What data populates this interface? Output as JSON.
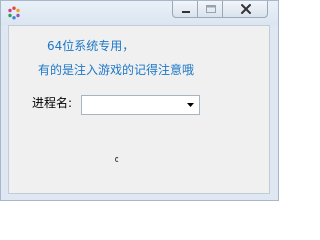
{
  "window": {
    "title": "",
    "icon": "app-icon",
    "titlebar_buttons": [
      {
        "name": "minimize",
        "icon": "minimize-icon"
      },
      {
        "name": "maximize",
        "icon": "maximize-icon"
      },
      {
        "name": "close",
        "icon": "close-icon"
      }
    ]
  },
  "notes": {
    "line1": "64位系统专用，",
    "line2": "有的是注入游戏的记得注意哦"
  },
  "process": {
    "label": "进程名:",
    "selected_value": ""
  },
  "colors": {
    "note_text": "#1c78c8",
    "titlebar": "#dfe8f2",
    "client_bg": "#f0f0f0"
  }
}
